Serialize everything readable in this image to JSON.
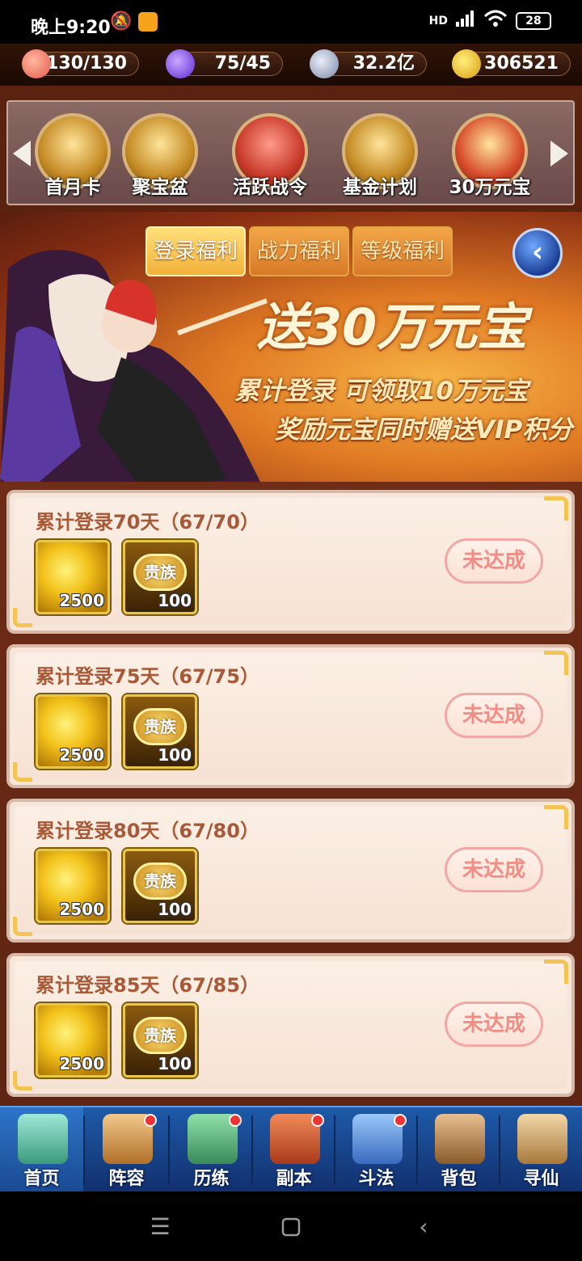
{
  "status_bar": {
    "time": "晚上9:20",
    "signal": "HD",
    "battery": "28"
  },
  "resources": [
    {
      "name": "peach",
      "value": "130/130"
    },
    {
      "name": "energy",
      "value": "75/45"
    },
    {
      "name": "coin",
      "value": "32.2亿"
    },
    {
      "name": "ingot",
      "value": "306521"
    }
  ],
  "carousel": {
    "items": [
      {
        "label": "首月卡",
        "icon": "month-card-icon"
      },
      {
        "label": "聚宝盆",
        "icon": "treasure-bowl-icon"
      },
      {
        "label": "活跃战令",
        "icon": "battle-pass-icon"
      },
      {
        "label": "基金计划",
        "icon": "fund-plan-icon"
      },
      {
        "label": "30万元宝",
        "icon": "ingot-gift-icon"
      }
    ]
  },
  "tabs": [
    {
      "label": "登录福利",
      "active": true
    },
    {
      "label": "战力福利",
      "active": false
    },
    {
      "label": "等级福利",
      "active": false
    }
  ],
  "banner": {
    "title": "送30万元宝",
    "line1": "累计登录 可领取10万元宝",
    "line2": "奖励元宝同时赠送VIP积分"
  },
  "rewards": [
    {
      "title": "累计登录70天（67/70）",
      "item1_qty": "2500",
      "item2_label": "贵族",
      "item2_qty": "100",
      "status": "未达成"
    },
    {
      "title": "累计登录75天（67/75）",
      "item1_qty": "2500",
      "item2_label": "贵族",
      "item2_qty": "100",
      "status": "未达成"
    },
    {
      "title": "累计登录80天（67/80）",
      "item1_qty": "2500",
      "item2_label": "贵族",
      "item2_qty": "100",
      "status": "未达成"
    },
    {
      "title": "累计登录85天（67/85）",
      "item1_qty": "2500",
      "item2_label": "贵族",
      "item2_qty": "100",
      "status": "未达成"
    }
  ],
  "bottom_nav": [
    {
      "label": "首页",
      "dot": false
    },
    {
      "label": "阵容",
      "dot": true
    },
    {
      "label": "历练",
      "dot": true
    },
    {
      "label": "副本",
      "dot": true
    },
    {
      "label": "斗法",
      "dot": true
    },
    {
      "label": "背包",
      "dot": false
    },
    {
      "label": "寻仙",
      "dot": false
    }
  ],
  "colors": {
    "accent": "#f2b13a",
    "nav_bg": "#1e5aa8",
    "status_pill": "#f08e86"
  }
}
